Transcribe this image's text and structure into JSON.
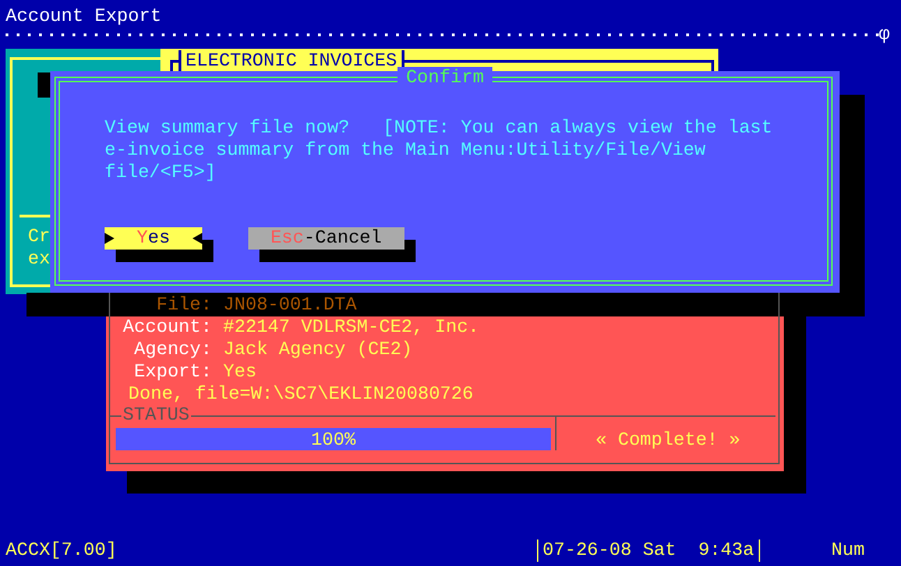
{
  "header": {
    "title": "Account Export",
    "ruler_mark": "φ"
  },
  "back_window": {
    "lines": [
      "Cr",
      "ex"
    ]
  },
  "invoices_window": {
    "title": "ELECTRONIC INVOICES"
  },
  "confirm_dialog": {
    "title": "Confirm",
    "message": "View summary file now?   [NOTE: You can always view the last\ne-invoice summary from the Main Menu:Utility/File/View\nfile/<F5>]",
    "buttons": [
      {
        "hotkey": "Y",
        "label": "es",
        "selected": true
      },
      {
        "hotkey": "Esc",
        "label": "-Cancel",
        "selected": false
      }
    ]
  },
  "export_window": {
    "file": {
      "label": "File:",
      "value": "JN08-001.DTA"
    },
    "fields": [
      {
        "label": "Account:",
        "value": "#22147 VDLRSM-CE2, Inc."
      },
      {
        "label": "Agency:",
        "value": "Jack Agency (CE2)"
      },
      {
        "label": "Export:",
        "value": "Yes"
      }
    ],
    "done": "Done, file=W:\\SC7\\EKLIN20080726",
    "status_label": "STATUS",
    "progress": {
      "level": 1,
      "reading": "100%"
    },
    "status_text": "« Complete! »"
  },
  "status_bar": {
    "app": "ACCX[7.00]",
    "datetime": "07-26-08 Sat  9:43a",
    "indicator": "Num"
  }
}
